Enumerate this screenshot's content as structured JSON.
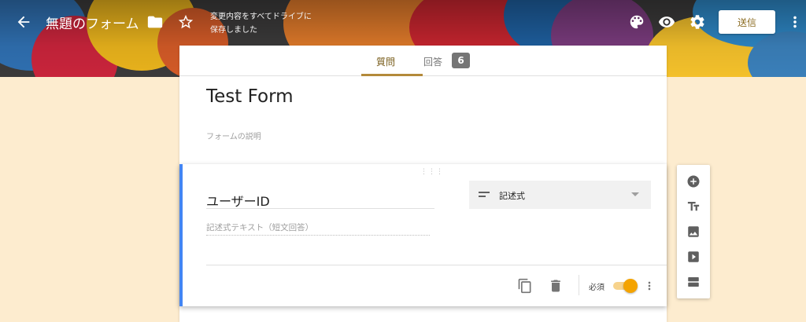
{
  "header": {
    "title": "無題のフォーム",
    "saved_status": "変更内容をすべてドライブに保存しました",
    "send_label": "送信",
    "icons": [
      "back-arrow-icon",
      "folder-icon",
      "star-icon",
      "palette-icon",
      "eye-icon",
      "gear-icon",
      "more-vert-icon"
    ]
  },
  "tabs": {
    "questions_label": "質問",
    "responses_label": "回答",
    "responses_count": "6"
  },
  "form": {
    "title": "Test Form",
    "description_placeholder": "フォームの説明"
  },
  "question": {
    "title": "ユーザーID",
    "answer_placeholder": "記述式テキスト（短文回答）",
    "type_label": "記述式",
    "required_label": "必須",
    "required": true
  },
  "sidebar": {
    "icons": [
      "add-question-icon",
      "add-title-icon",
      "add-image-icon",
      "add-video-icon",
      "add-section-icon"
    ]
  },
  "colors": {
    "accent": "#b38a3a",
    "background": "#fdeccf",
    "toggle": "#f4a300",
    "card_highlight": "#4285f4"
  }
}
